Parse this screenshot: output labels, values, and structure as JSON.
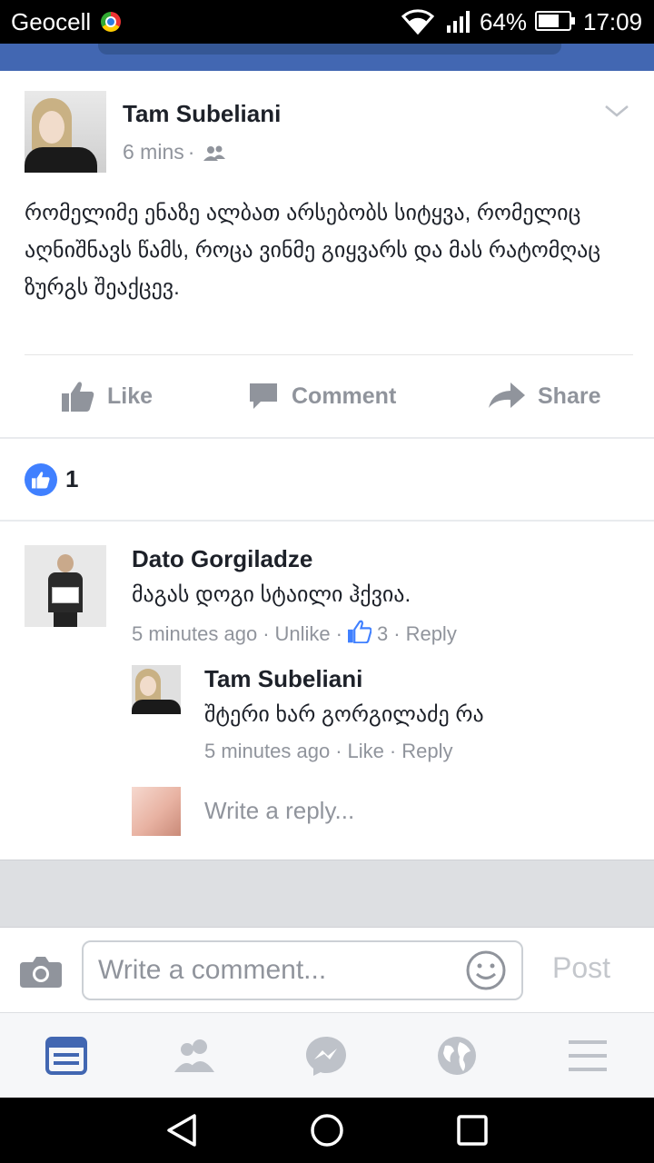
{
  "status_bar": {
    "carrier": "Geocell",
    "battery": "64%",
    "time": "17:09"
  },
  "post": {
    "author": "Tam Subeliani",
    "time": "6 mins",
    "privacy_icon": "friends-icon",
    "text": "რომელიმე ენაზე ალბათ არსებობს სიტყვა, რომელიც აღნიშნავს წამს, როცა ვინმე გიყვარს და მას რატომღაც ზურგს შეაქცევ.",
    "actions": {
      "like": "Like",
      "comment": "Comment",
      "share": "Share"
    }
  },
  "reactions": {
    "count": "1"
  },
  "comments": [
    {
      "author": "Dato Gorgiladze",
      "text": "მაგას დოგი სტაილი ჰქვია.",
      "time": "5 minutes ago",
      "action": "Unlike",
      "likes": "3",
      "reply": "Reply"
    },
    {
      "author": "Tam Subeliani",
      "text": "შტერი ხარ გორგილაძე რა",
      "time": "5 minutes ago",
      "action": "Like",
      "reply": "Reply"
    }
  ],
  "reply_placeholder": "Write a reply...",
  "composer": {
    "placeholder": "Write a comment...",
    "post_label": "Post"
  },
  "colors": {
    "fb_blue": "#4267b2",
    "like_blue": "#4080ff",
    "meta_gray": "#90949c"
  }
}
